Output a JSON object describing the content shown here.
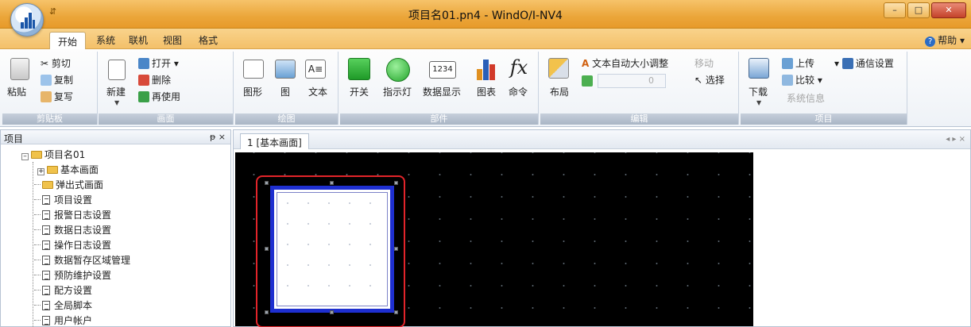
{
  "window": {
    "title": "项目名01.pn4 - WindO/I-NV4",
    "qat": "⇵",
    "controls": [
      "–",
      "□",
      "✕"
    ]
  },
  "ribbon_tabs": [
    "开始",
    "系统",
    "联机",
    "视图",
    "格式"
  ],
  "help_label": "帮助",
  "groups": {
    "clipboard": {
      "label": "剪贴板",
      "paste": "粘贴",
      "cut": "剪切",
      "copy": "复制",
      "duplicate": "复写"
    },
    "screen": {
      "label": "画面",
      "new": "新建",
      "open": "打开",
      "delete": "删除",
      "reuse": "再使用"
    },
    "draw": {
      "label": "绘图",
      "shape": "图形",
      "picture": "图",
      "text": "文本"
    },
    "parts": {
      "label": "部件",
      "switch": "开关",
      "pilot_lamp": "指示灯",
      "numeric_display": "数据显示",
      "chart": "图表",
      "command": "命令",
      "numeric_icon": "1234",
      "fx_icon": "fx"
    },
    "edit": {
      "label": "编辑",
      "layout": "布局",
      "auto_text_size": "文本自动大小调整",
      "select": "选择",
      "disabled_top": "移动",
      "spin_value": "0"
    },
    "project": {
      "label": "项目",
      "download": "下载",
      "upload": "上传",
      "compare": "比较",
      "comm_settings": "通信设置",
      "system_info": "系统信息"
    }
  },
  "left_panel": {
    "title": "项目",
    "controls": "ᵽ ×",
    "tree": [
      {
        "label": "项目名01",
        "type": "root-folder"
      },
      {
        "label": "基本画面",
        "type": "folder"
      },
      {
        "label": "弹出式画面",
        "type": "folder"
      },
      {
        "label": "项目设置",
        "type": "doc"
      },
      {
        "label": "报警日志设置",
        "type": "doc"
      },
      {
        "label": "数据日志设置",
        "type": "doc"
      },
      {
        "label": "操作日志设置",
        "type": "doc"
      },
      {
        "label": "数据暂存区域管理",
        "type": "doc"
      },
      {
        "label": "预防维护设置",
        "type": "doc"
      },
      {
        "label": "配方设置",
        "type": "doc"
      },
      {
        "label": "全局脚本",
        "type": "doc"
      },
      {
        "label": "用户帐户",
        "type": "doc"
      }
    ]
  },
  "editor": {
    "tab_label": "1 [基本画面]",
    "tab_controls": "◂ ▸ ×"
  },
  "colors": {
    "canvas": "#000000",
    "highlight_frame": "#e2242a",
    "selected_shape_border": "#1e2fd0"
  }
}
